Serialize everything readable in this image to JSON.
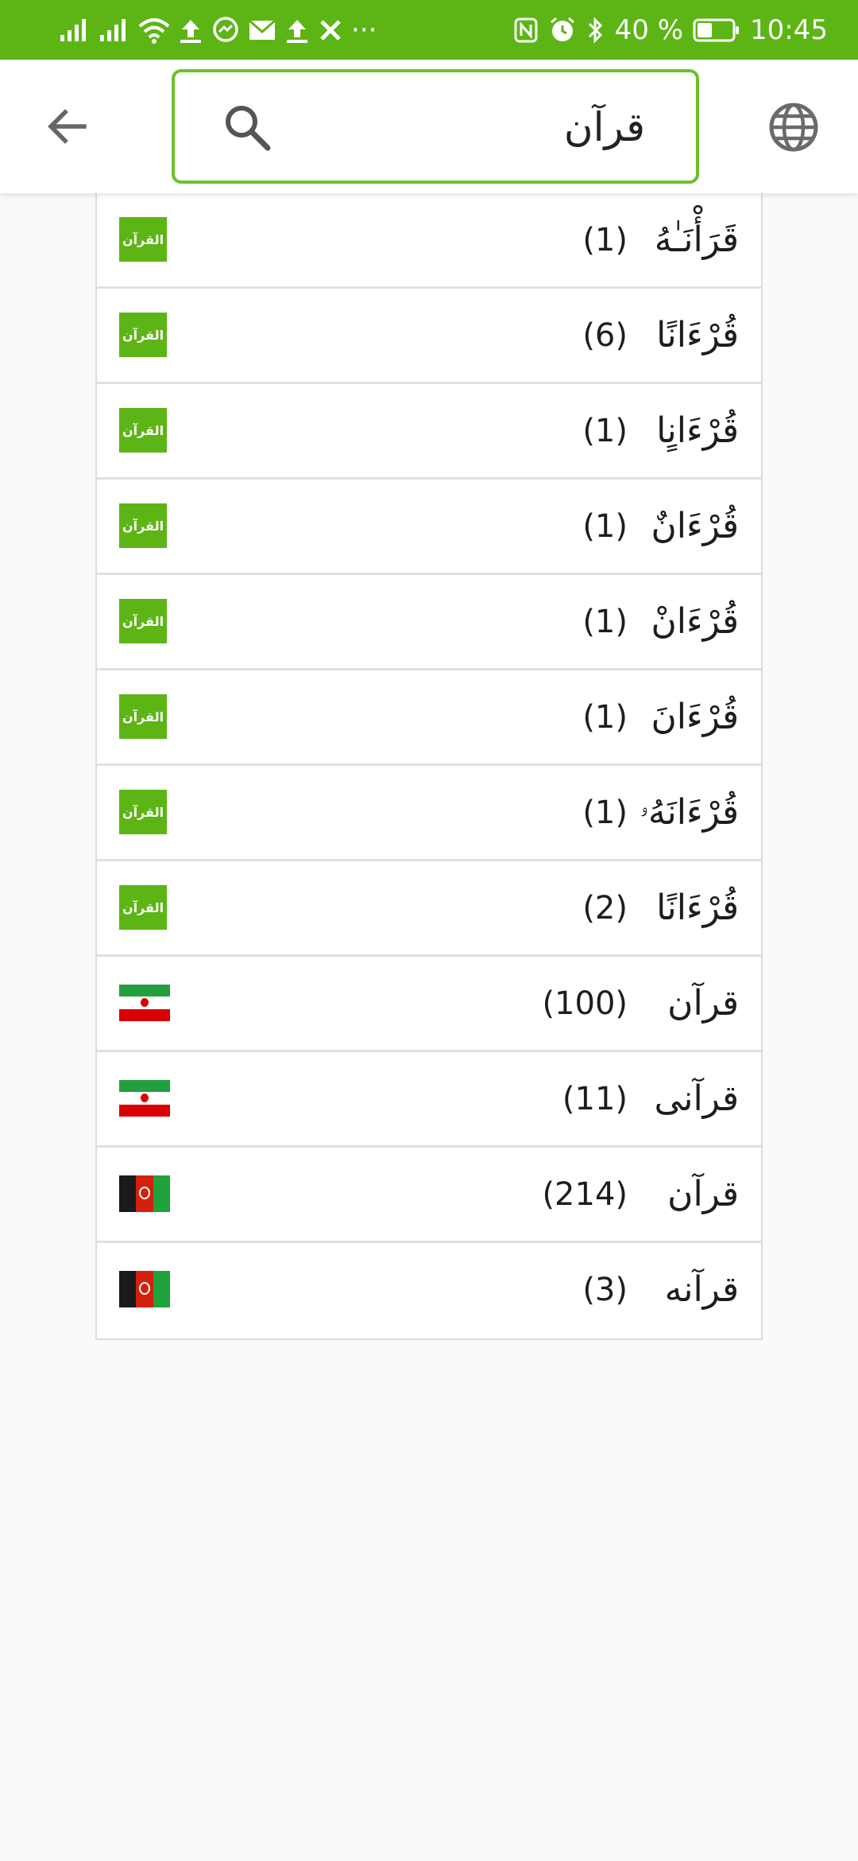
{
  "status_bar": {
    "battery_percent": "40 %",
    "time": "10:45",
    "more_dots": "···",
    "icons": [
      "signal-icon",
      "signal-icon",
      "wifi-icon",
      "upload-icon",
      "messenger-icon",
      "mail-icon",
      "upload-icon",
      "tools-icon",
      "nfc-icon",
      "alarm-icon",
      "bluetooth-icon",
      "battery-icon"
    ]
  },
  "search": {
    "value": "قرآن"
  },
  "badge_label": "القرآن",
  "colors": {
    "accent": "#5cb515",
    "search_border": "#6cc12b"
  },
  "results": [
    {
      "word": "قَرَأْنَـٰهُ",
      "count": "(1)",
      "source": "quran"
    },
    {
      "word": "قُرْءَانًا",
      "count": "(6)",
      "source": "quran"
    },
    {
      "word": "قُرْءَانٍا",
      "count": "(1)",
      "source": "quran"
    },
    {
      "word": "قُرْءَانٌ",
      "count": "(1)",
      "source": "quran"
    },
    {
      "word": "قُرْءَانْ",
      "count": "(1)",
      "source": "quran"
    },
    {
      "word": "قُرْءَانَ",
      "count": "(1)",
      "source": "quran"
    },
    {
      "word": "قُرْءَانَهُۥ",
      "count": "(1)",
      "source": "quran"
    },
    {
      "word": "قُرْءَانًا",
      "count": "(2)",
      "source": "quran"
    },
    {
      "word": "قرآن",
      "count": "(100)",
      "source": "iran"
    },
    {
      "word": "قرآنی",
      "count": "(11)",
      "source": "iran"
    },
    {
      "word": "قرآن",
      "count": "(214)",
      "source": "afghanistan"
    },
    {
      "word": "قرآنه",
      "count": "(3)",
      "source": "afghanistan"
    }
  ]
}
